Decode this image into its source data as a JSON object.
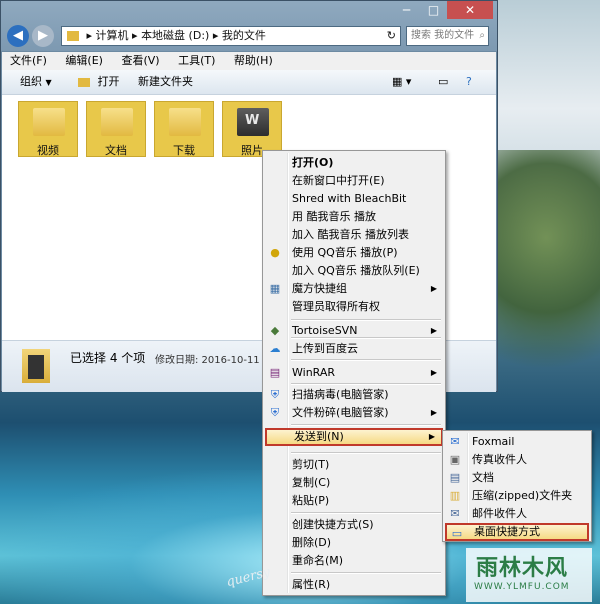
{
  "window": {
    "breadcrumb": [
      "计算机",
      "本地磁盘 (D:)",
      "我的文件"
    ],
    "search_placeholder": "搜索 我的文件",
    "menu": [
      "文件(F)",
      "编辑(E)",
      "查看(V)",
      "工具(T)",
      "帮助(H)"
    ],
    "toolbar": {
      "organize": "组织",
      "open": "打开",
      "new_folder": "新建文件夹"
    },
    "folders": [
      "视频",
      "文档",
      "下载",
      "照片"
    ],
    "details": {
      "selected": "已选择 4 个项",
      "modified": "修改日期: 2016-10-11 11:3"
    }
  },
  "context_menu": [
    {
      "label": "打开(O)",
      "bold": true
    },
    {
      "label": "在新窗口中打开(E)"
    },
    {
      "label": "Shred with BleachBit"
    },
    {
      "label": "用 酷我音乐 播放"
    },
    {
      "label": "加入 酷我音乐 播放列表"
    },
    {
      "label": "使用 QQ音乐 播放(P)",
      "icon": "qq-music-icon"
    },
    {
      "label": "加入 QQ音乐 播放队列(E)"
    },
    {
      "label": "魔方快捷组",
      "icon": "grid-icon",
      "submenu": true
    },
    {
      "label": "管理员取得所有权"
    },
    {
      "label": "TortoiseSVN",
      "icon": "tortoise-icon",
      "submenu": true
    },
    {
      "label": "上传到百度云",
      "icon": "cloud-icon"
    },
    {
      "label": "WinRAR",
      "icon": "winrar-icon",
      "submenu": true
    },
    {
      "label": "扫描病毒(电脑管家)",
      "icon": "shield-icon"
    },
    {
      "label": "文件粉碎(电脑管家)",
      "icon": "shield-icon",
      "submenu": true
    },
    {
      "label": "发送到(N)",
      "submenu": true,
      "highlighted": true
    },
    {
      "label": "剪切(T)"
    },
    {
      "label": "复制(C)"
    },
    {
      "label": "粘贴(P)"
    },
    {
      "label": "创建快捷方式(S)"
    },
    {
      "label": "删除(D)"
    },
    {
      "label": "重命名(M)"
    },
    {
      "label": "属性(R)"
    }
  ],
  "send_to_menu": [
    {
      "label": "Foxmail",
      "icon": "foxmail-icon"
    },
    {
      "label": "传真收件人",
      "icon": "fax-icon"
    },
    {
      "label": "文档",
      "icon": "document-icon"
    },
    {
      "label": "压缩(zipped)文件夹",
      "icon": "zip-folder-icon"
    },
    {
      "label": "邮件收件人",
      "icon": "mail-icon"
    },
    {
      "label": "桌面快捷方式",
      "icon": "desktop-icon",
      "highlighted": true
    }
  ],
  "watermark": {
    "main": "雨林木风",
    "sub": "WWW.YLMFU.COM",
    "signature": "quersy"
  },
  "colors": {
    "highlight_border": "#c0392b",
    "folder_selected": "#e8c84a",
    "watermark": "#2b7d46"
  }
}
